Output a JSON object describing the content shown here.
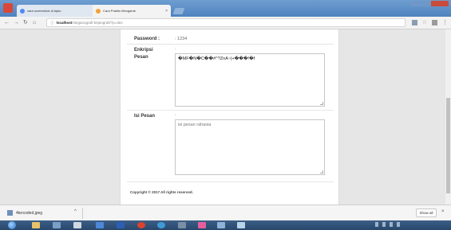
{
  "browser": {
    "tabs": [
      {
        "title": "cara screenshot di lapto",
        "close": "×"
      },
      {
        "title": "Cara Praktis Mengamb",
        "close": "×"
      }
    ],
    "address": {
      "host": "localhost",
      "path": "/steganografi-kriptografi/?p=des"
    }
  },
  "form": {
    "password_label": "Password :",
    "password_value": ": 1234",
    "enkripsi_label": "Enkripsi Pesan",
    "enkripsi_colon": ":",
    "enkripsi_value": "�MF�N�C��#^?ZnA~|+���!�f",
    "isi_label": "Isi Pesan",
    "isi_colon": ":",
    "isi_value": "isi pesan rahasia",
    "copyright": "Copyright © 2017 All rights reserved."
  },
  "downloads": {
    "file_name": "4tercoded.jpeg",
    "arrow": "^",
    "show_all": "Show all",
    "close": "×"
  },
  "colors": {
    "tab_strip": "#5a8cc8",
    "page_bg": "#e6e6e6",
    "card_bg": "#ffffff",
    "taskbar": "#2f5079"
  }
}
